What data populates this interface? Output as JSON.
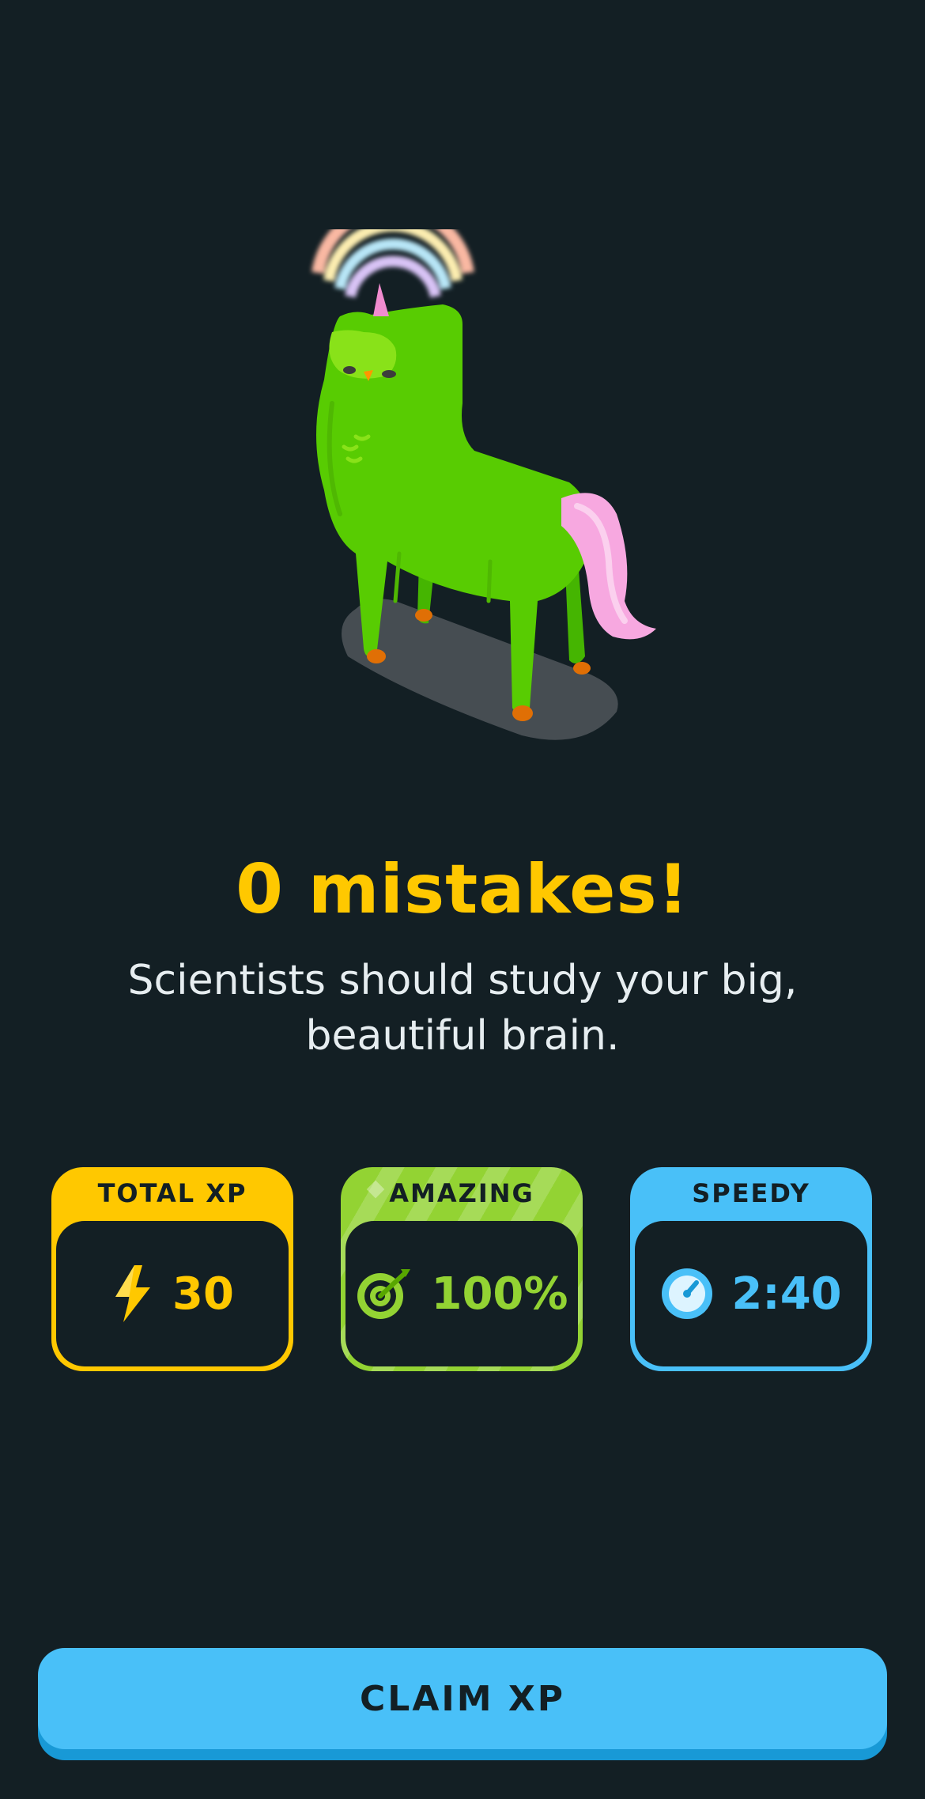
{
  "result": {
    "headline": "0 mistakes!",
    "subtitle": "Scientists should study your big, beautiful brain."
  },
  "stats": [
    {
      "label": "TOTAL XP",
      "value": "30",
      "icon": "lightning-bolt-icon",
      "color": "#ffc800"
    },
    {
      "label": "AMAZING",
      "value": "100%",
      "icon": "target-icon",
      "color": "#93d333"
    },
    {
      "label": "SPEEDY",
      "value": "2:40",
      "icon": "stopwatch-icon",
      "color": "#49c0f8"
    }
  ],
  "actions": {
    "claim_label": "CLAIM XP"
  },
  "colors": {
    "background": "#131f24",
    "accent_yellow": "#ffc800",
    "accent_green": "#93d333",
    "accent_blue": "#49c0f8",
    "mascot_green": "#58cc02",
    "mane_pink": "#f7a8e0"
  }
}
